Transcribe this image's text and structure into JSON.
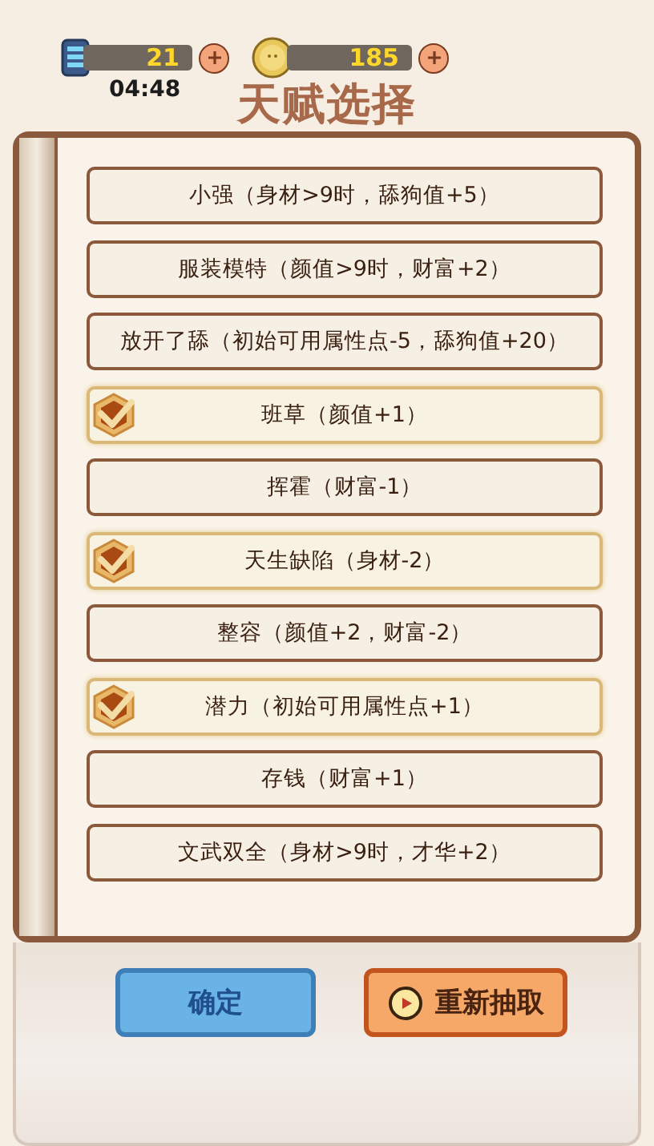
{
  "resources": {
    "energy": "21",
    "timer": "04:48",
    "coins": "185"
  },
  "title": "天赋选择",
  "talents": [
    {
      "label": "小强（身材>9时，舔狗值+5）",
      "selected": false
    },
    {
      "label": "服装模特（颜值>9时，财富+2）",
      "selected": false
    },
    {
      "label": "放开了舔（初始可用属性点-5，舔狗值+20）",
      "selected": false
    },
    {
      "label": "班草（颜值+1）",
      "selected": true
    },
    {
      "label": "挥霍（财富-1）",
      "selected": false
    },
    {
      "label": "天生缺陷（身材-2）",
      "selected": true
    },
    {
      "label": "整容（颜值+2，财富-2）",
      "selected": false
    },
    {
      "label": "潜力（初始可用属性点+1）",
      "selected": true
    },
    {
      "label": "存钱（财富+1）",
      "selected": false
    },
    {
      "label": "文武双全（身材>9时，才华+2）",
      "selected": false
    }
  ],
  "buttons": [
    {
      "kind": "confirm",
      "label": "确定"
    },
    {
      "kind": "reroll",
      "label": "重新抽取"
    }
  ]
}
